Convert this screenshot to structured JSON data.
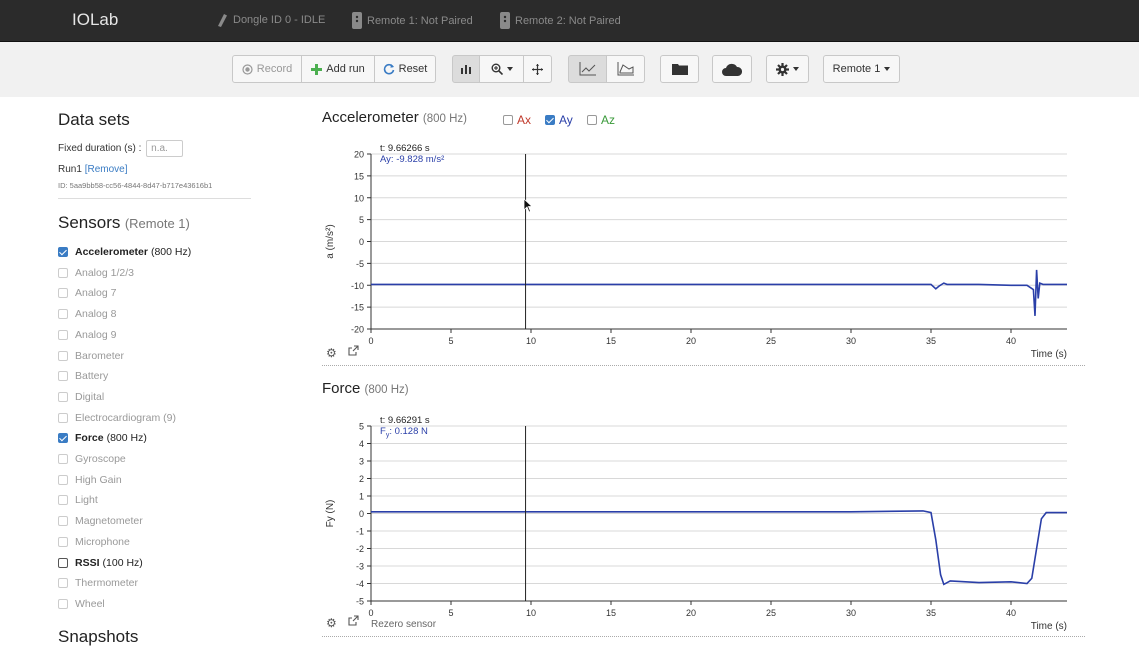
{
  "navbar": {
    "brand": "IOLab",
    "dongle": "Dongle ID 0 - IDLE",
    "remote1": "Remote 1: Not Paired",
    "remote2": "Remote 2: Not Paired"
  },
  "toolbar": {
    "record": "Record",
    "add_run": "Add run",
    "reset": "Reset",
    "remote_select": "Remote 1"
  },
  "sidebar": {
    "datasets_title": "Data sets",
    "fixed_duration_label": "Fixed duration (s) :",
    "fixed_duration_placeholder": "n.a.",
    "run_name": "Run1",
    "run_remove": "[Remove]",
    "run_id": "ID: 5aa9bb58-cc56-4844-8d47-b717e43616b1",
    "sensors_title": "Sensors",
    "sensors_remote": "(Remote 1)",
    "sensors": [
      {
        "name": "Accelerometer",
        "rate": "(800 Hz)",
        "state": "checked"
      },
      {
        "name": "Analog 1/2/3",
        "rate": "",
        "state": "disabled"
      },
      {
        "name": "Analog 7",
        "rate": "",
        "state": "disabled"
      },
      {
        "name": "Analog 8",
        "rate": "",
        "state": "disabled"
      },
      {
        "name": "Analog 9",
        "rate": "",
        "state": "disabled"
      },
      {
        "name": "Barometer",
        "rate": "",
        "state": "disabled"
      },
      {
        "name": "Battery",
        "rate": "",
        "state": "disabled"
      },
      {
        "name": "Digital",
        "rate": "",
        "state": "disabled"
      },
      {
        "name": "Electrocardiogram (9)",
        "rate": "",
        "state": "disabled"
      },
      {
        "name": "Force",
        "rate": "(800 Hz)",
        "state": "checked"
      },
      {
        "name": "Gyroscope",
        "rate": "",
        "state": "disabled"
      },
      {
        "name": "High Gain",
        "rate": "",
        "state": "disabled"
      },
      {
        "name": "Light",
        "rate": "",
        "state": "disabled"
      },
      {
        "name": "Magnetometer",
        "rate": "",
        "state": "disabled"
      },
      {
        "name": "Microphone",
        "rate": "",
        "state": "disabled"
      },
      {
        "name": "RSSI",
        "rate": "(100 Hz)",
        "state": "unchecked"
      },
      {
        "name": "Thermometer",
        "rate": "",
        "state": "disabled"
      },
      {
        "name": "Wheel",
        "rate": "",
        "state": "disabled"
      }
    ],
    "snapshots_title": "Snapshots"
  },
  "accel_panel": {
    "title": "Accelerometer",
    "rate": "(800 Hz)",
    "toggles": [
      {
        "label": "Ax",
        "checked": false,
        "color": "#c0392b"
      },
      {
        "label": "Ay",
        "checked": true,
        "color": "#2a3fa8"
      },
      {
        "label": "Az",
        "checked": false,
        "color": "#3a9a3a"
      }
    ],
    "cursor_t": "t: 9.66266 s",
    "cursor_val": "Ay: -9.828 m/s²"
  },
  "force_panel": {
    "title": "Force",
    "rate": "(800 Hz)",
    "cursor_t": "t: 9.66291 s",
    "cursor_val_prefix": "F",
    "cursor_val_sub": "y",
    "cursor_val": ": 0.128 N",
    "rezero": "Rezero sensor"
  },
  "chart_data": [
    {
      "type": "line",
      "title": "Accelerometer",
      "xlabel": "Time (s)",
      "ylabel": "a (m/s²)",
      "xlim": [
        0,
        43.5
      ],
      "ylim": [
        -20,
        20
      ],
      "xticks": [
        0,
        5,
        10,
        15,
        20,
        25,
        30,
        35,
        40
      ],
      "yticks": [
        -20,
        -15,
        -10,
        -5,
        0,
        5,
        10,
        15,
        20
      ],
      "cursor_x": 9.66,
      "series": [
        {
          "name": "Ay",
          "color": "#2a3fa8",
          "x": [
            0,
            5,
            10,
            15,
            20,
            25,
            30,
            35,
            35.3,
            35.5,
            35.8,
            36,
            38,
            40,
            41,
            41.4,
            41.5,
            41.6,
            41.7,
            41.8,
            42,
            43.5
          ],
          "y": [
            -9.8,
            -9.8,
            -9.8,
            -9.8,
            -9.8,
            -9.8,
            -9.8,
            -9.8,
            -10.8,
            -10.2,
            -9.5,
            -9.8,
            -9.8,
            -10,
            -10,
            -11,
            -17,
            -6.5,
            -13,
            -9.5,
            -9.8,
            -9.8
          ]
        }
      ]
    },
    {
      "type": "line",
      "title": "Force",
      "xlabel": "Time (s)",
      "ylabel": "Fy (N)",
      "xlim": [
        0,
        43.5
      ],
      "ylim": [
        -5,
        5
      ],
      "xticks": [
        0,
        5,
        10,
        15,
        20,
        25,
        30,
        35,
        40
      ],
      "yticks": [
        -5,
        -4,
        -3,
        -2,
        -1,
        0,
        1,
        2,
        3,
        4,
        5
      ],
      "cursor_x": 9.66,
      "series": [
        {
          "name": "Fy",
          "color": "#2a3fa8",
          "x": [
            0,
            10,
            20,
            30,
            34.5,
            35,
            35.3,
            35.6,
            35.8,
            36.2,
            38,
            40,
            41,
            41.3,
            41.6,
            41.9,
            42.2,
            43.5
          ],
          "y": [
            0.1,
            0.1,
            0.1,
            0.1,
            0.15,
            0.05,
            -1.5,
            -3.5,
            -4.05,
            -3.85,
            -3.95,
            -3.9,
            -4.0,
            -3.7,
            -2,
            -0.3,
            0.05,
            0.05
          ]
        }
      ]
    }
  ]
}
